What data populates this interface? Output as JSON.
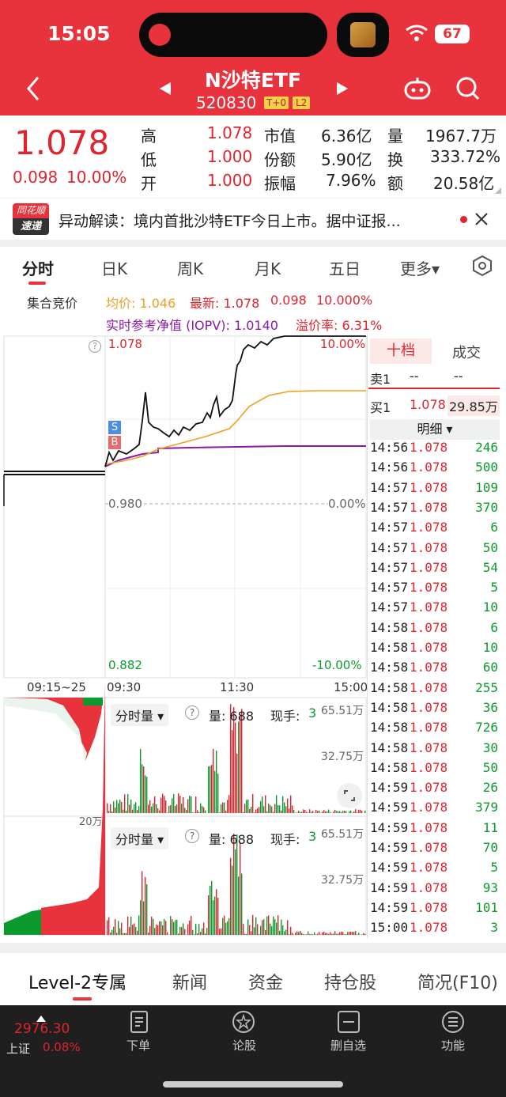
{
  "status_bar": {
    "time": "15:05",
    "battery": "67"
  },
  "header": {
    "name": "N沙特ETF",
    "code": "520830",
    "badge1": "T+0",
    "badge2": "L2"
  },
  "quote": {
    "price": "1.078",
    "change": "0.098",
    "change_pct": "10.00%",
    "high_label": "高",
    "high": "1.078",
    "low_label": "低",
    "low": "1.000",
    "open_label": "开",
    "open": "1.000",
    "mcap_label": "市值",
    "mcap": "6.36亿",
    "share_label": "份额",
    "share": "5.90亿",
    "amp_label": "振幅",
    "amp": "7.96%",
    "vol_label": "量",
    "vol": "1967.7万",
    "turn_label": "换",
    "turn": "333.72%",
    "amt_label": "额",
    "amt": "20.58亿"
  },
  "news": {
    "logo_top": "同花顺",
    "logo_bottom": "速递",
    "text": "异动解读：境内首批沙特ETF今日上市。据中证报..."
  },
  "tabs": [
    "分时",
    "日K",
    "周K",
    "月K",
    "五日",
    "更多▾"
  ],
  "info": {
    "auction": "集合竞价",
    "avg": "均价: 1.046",
    "latest": "最新: 1.078",
    "chg": "0.098",
    "pct": "10.000%",
    "iopv": "实时参考净值 (IOPV): 1.0140",
    "premium": "溢价率: 6.31%"
  },
  "chart": {
    "top_price": "1.078",
    "top_pct": "10.00%",
    "mid_price": "0.980",
    "mid_pct": "0.00%",
    "bot_price": "0.882",
    "bot_pct": "-10.00%",
    "t0": "09:15~25",
    "t1": "09:30",
    "t2": "11:30",
    "t3": "15:00",
    "s_marker": "S",
    "b_marker": "B",
    "help": "?"
  },
  "volume": {
    "label": "分时量 ▾",
    "qty": "量: 688",
    "hand_label": "现手:",
    "hand": "3",
    "max": "65.51万",
    "mid": "32.75万",
    "side": "20万"
  },
  "order": {
    "tab1": "十档",
    "tab2": "成交",
    "sell1": "卖1",
    "sell1_p": "--",
    "sell1_v": "--",
    "buy1": "买1",
    "buy1_p": "1.078",
    "buy1_v": "29.85万",
    "detail": "明细 ▾"
  },
  "trades": [
    {
      "t": "14:56",
      "p": "1.078",
      "v": "246",
      "c": "g"
    },
    {
      "t": "14:56",
      "p": "1.078",
      "v": "500",
      "c": "g"
    },
    {
      "t": "14:57",
      "p": "1.078",
      "v": "109",
      "c": "g"
    },
    {
      "t": "14:57",
      "p": "1.078",
      "v": "370",
      "c": "g"
    },
    {
      "t": "14:57",
      "p": "1.078",
      "v": "6",
      "c": "g"
    },
    {
      "t": "14:57",
      "p": "1.078",
      "v": "50",
      "c": "g"
    },
    {
      "t": "14:57",
      "p": "1.078",
      "v": "54",
      "c": "g"
    },
    {
      "t": "14:57",
      "p": "1.078",
      "v": "5",
      "c": "g"
    },
    {
      "t": "14:57",
      "p": "1.078",
      "v": "10",
      "c": "g"
    },
    {
      "t": "14:58",
      "p": "1.078",
      "v": "6",
      "c": "g"
    },
    {
      "t": "14:58",
      "p": "1.078",
      "v": "10",
      "c": "g"
    },
    {
      "t": "14:58",
      "p": "1.078",
      "v": "60",
      "c": "g"
    },
    {
      "t": "14:58",
      "p": "1.078",
      "v": "255",
      "c": "g"
    },
    {
      "t": "14:58",
      "p": "1.078",
      "v": "36",
      "c": "g"
    },
    {
      "t": "14:58",
      "p": "1.078",
      "v": "726",
      "c": "g"
    },
    {
      "t": "14:58",
      "p": "1.078",
      "v": "30",
      "c": "g"
    },
    {
      "t": "14:58",
      "p": "1.078",
      "v": "50",
      "c": "g"
    },
    {
      "t": "14:59",
      "p": "1.078",
      "v": "26",
      "c": "g"
    },
    {
      "t": "14:59",
      "p": "1.078",
      "v": "379",
      "c": "g"
    },
    {
      "t": "14:59",
      "p": "1.078",
      "v": "11",
      "c": "g"
    },
    {
      "t": "14:59",
      "p": "1.078",
      "v": "70",
      "c": "g"
    },
    {
      "t": "14:59",
      "p": "1.078",
      "v": "5",
      "c": "g"
    },
    {
      "t": "14:59",
      "p": "1.078",
      "v": "93",
      "c": "g"
    },
    {
      "t": "14:59",
      "p": "1.078",
      "v": "101",
      "c": "g"
    },
    {
      "t": "15:00",
      "p": "1.078",
      "v": "3",
      "c": "g"
    }
  ],
  "bottom_tabs": [
    "Level-2专属",
    "新闻",
    "资金",
    "持仓股",
    "简况(F10)"
  ],
  "nav": {
    "index_val": "2976.30",
    "index_name": "上证",
    "index_pct": "0.08%",
    "items": [
      "下单",
      "论股",
      "删自选",
      "功能"
    ]
  },
  "colors": {
    "brand": "#e8323c",
    "up": "#e0242e",
    "down": "#0c9a2e",
    "avg": "#f0a020",
    "iopv": "#8a1aa8"
  }
}
